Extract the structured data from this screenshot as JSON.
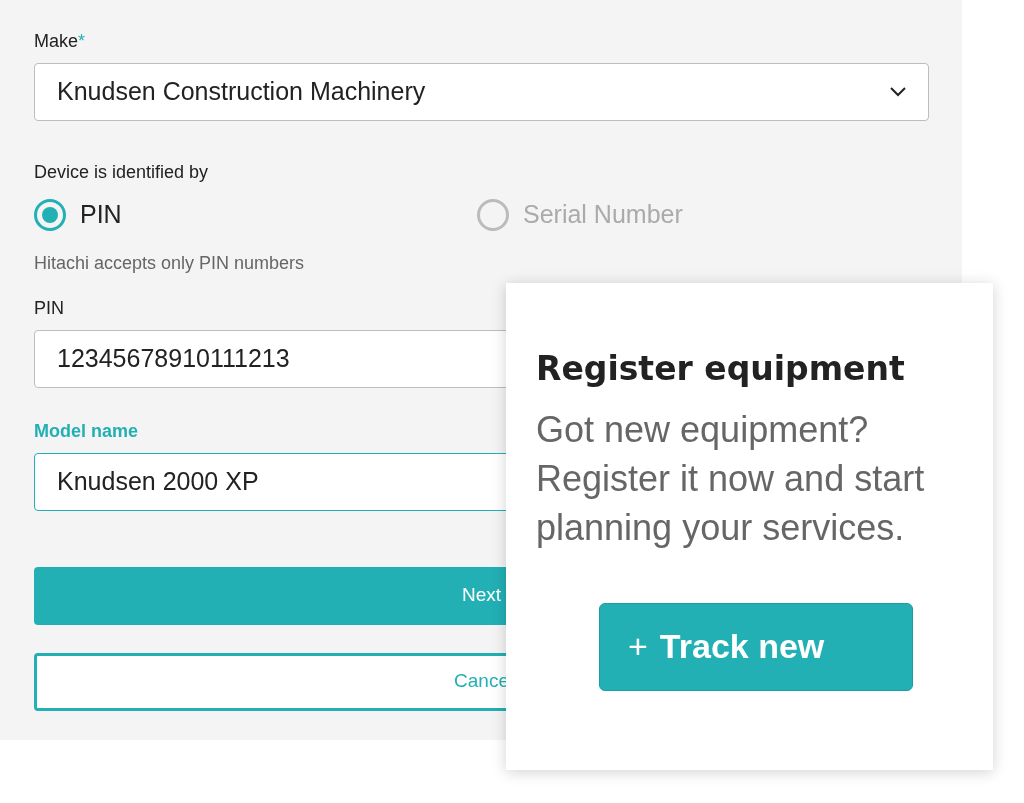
{
  "form": {
    "make": {
      "label": "Make",
      "required_mark": "*",
      "value": "Knudsen Construction Machinery"
    },
    "identified_by": {
      "label": "Device is identified by",
      "options": [
        {
          "label": "PIN",
          "selected": true,
          "disabled": false
        },
        {
          "label": "Serial Number",
          "selected": false,
          "disabled": true
        }
      ],
      "hint": "Hitachi accepts only PIN numbers"
    },
    "fields": [
      {
        "label": "PIN",
        "value": "12345678910111213",
        "focused": false
      },
      {
        "label": "Model name",
        "value": "Knudsen 2000 XP",
        "focused": true
      }
    ],
    "buttons": [
      {
        "label": "Next",
        "kind": "primary"
      },
      {
        "label": "Cance",
        "kind": "outline"
      }
    ]
  },
  "card": {
    "title": "Register equipment",
    "text": "Got new equipment? Register it now and start planning your services.",
    "button": {
      "icon": "+",
      "label": "Track new"
    }
  }
}
